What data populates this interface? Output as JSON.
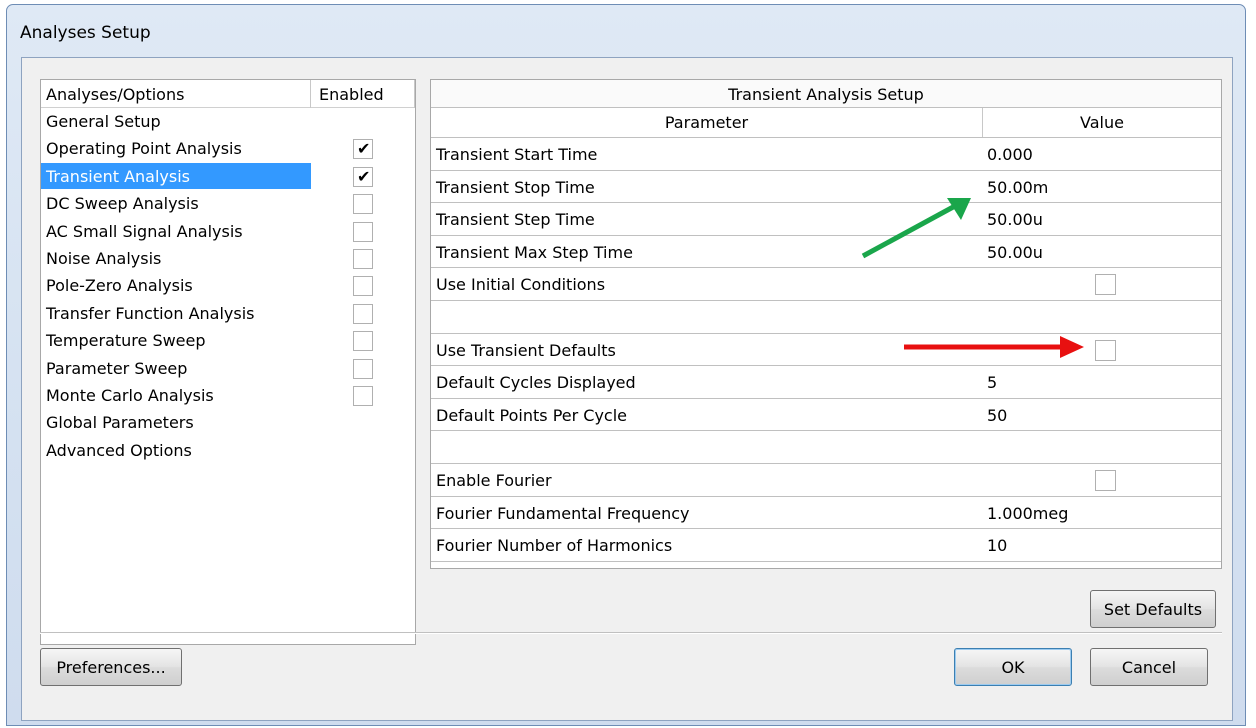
{
  "window": {
    "title": "Analyses Setup"
  },
  "left_panel": {
    "headers": {
      "name": "Analyses/Options",
      "enabled": "Enabled"
    },
    "items": [
      {
        "label": "General Setup",
        "checkbox": false
      },
      {
        "label": "Operating Point Analysis",
        "checkbox": true,
        "checked": true
      },
      {
        "label": "Transient Analysis",
        "checkbox": true,
        "checked": true,
        "selected": true
      },
      {
        "label": "DC Sweep Analysis",
        "checkbox": true,
        "checked": false
      },
      {
        "label": "AC Small Signal Analysis",
        "checkbox": true,
        "checked": false
      },
      {
        "label": "Noise Analysis",
        "checkbox": true,
        "checked": false
      },
      {
        "label": "Pole-Zero Analysis",
        "checkbox": true,
        "checked": false
      },
      {
        "label": "Transfer Function Analysis",
        "checkbox": true,
        "checked": false
      },
      {
        "label": "Temperature Sweep",
        "checkbox": true,
        "checked": false
      },
      {
        "label": "Parameter Sweep",
        "checkbox": true,
        "checked": false
      },
      {
        "label": "Monte Carlo Analysis",
        "checkbox": true,
        "checked": false
      },
      {
        "label": "Global Parameters",
        "checkbox": false
      },
      {
        "label": "Advanced Options",
        "checkbox": false
      }
    ]
  },
  "right_panel": {
    "title": "Transient Analysis Setup",
    "headers": {
      "parameter": "Parameter",
      "value": "Value"
    },
    "rows": [
      {
        "name": "Transient Start Time",
        "value": "0.000"
      },
      {
        "name": "Transient Stop Time",
        "value": "50.00m"
      },
      {
        "name": "Transient Step Time",
        "value": "50.00u"
      },
      {
        "name": "Transient Max Step Time",
        "value": "50.00u"
      },
      {
        "name": "Use Initial Conditions",
        "checkbox": true,
        "checked": false
      },
      {
        "name": "",
        "value": ""
      },
      {
        "name": "Use Transient Defaults",
        "checkbox": true,
        "checked": false
      },
      {
        "name": "Default Cycles Displayed",
        "value": "5"
      },
      {
        "name": "Default Points Per Cycle",
        "value": "50"
      },
      {
        "name": "",
        "value": ""
      },
      {
        "name": "Enable Fourier",
        "checkbox": true,
        "checked": false
      },
      {
        "name": "Fourier Fundamental Frequency",
        "value": "1.000meg"
      },
      {
        "name": "Fourier Number of Harmonics",
        "value": "10"
      }
    ]
  },
  "buttons": {
    "set_defaults": "Set Defaults",
    "preferences": "Preferences...",
    "ok": "OK",
    "cancel": "Cancel"
  },
  "annotations": {
    "green_arrow_color": "#1aa64b",
    "red_arrow_color": "#e81010"
  }
}
